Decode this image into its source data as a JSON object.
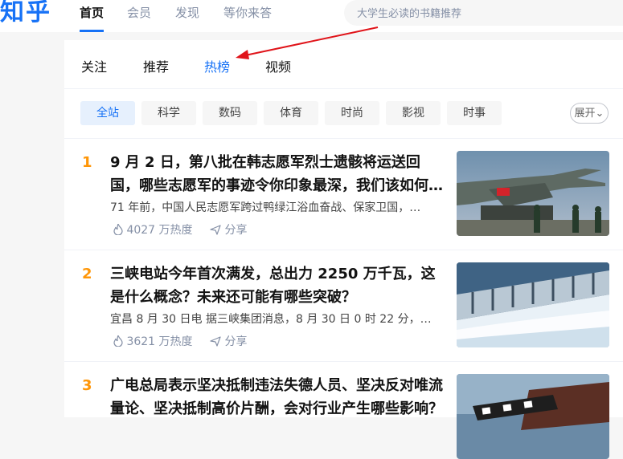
{
  "header": {
    "logo": "知乎",
    "nav": [
      "首页",
      "会员",
      "发现",
      "等你来答"
    ],
    "search_placeholder": "大学生必读的书籍推荐"
  },
  "tabs": [
    "关注",
    "推荐",
    "热榜",
    "视频"
  ],
  "active_tab": "热榜",
  "categories": [
    "全站",
    "科学",
    "数码",
    "体育",
    "时尚",
    "影视",
    "时事"
  ],
  "expand_label": "展开",
  "hot_list": [
    {
      "rank": "1",
      "title": "9 月 2 日，第八批在韩志愿军烈士遗骸将运送回国，哪些志愿军的事迹令你印象最深，我们该如何…",
      "excerpt": "71 年前，中国人民志愿军跨过鸭绿江浴血奋战、保家卫国，…",
      "heat": "4027 万热度",
      "share": "分享"
    },
    {
      "rank": "2",
      "title": "三峡电站今年首次满发，总出力 2250 万千瓦，这是什么概念？未来还可能有哪些突破？",
      "excerpt": "宜昌 8 月 30 日电 据三峡集团消息，8 月 30 日 0 时 22 分，…",
      "heat": "3621 万热度",
      "share": "分享"
    },
    {
      "rank": "3",
      "title": "广电总局表示坚决抵制违法失德人员、坚决反对唯流量论、坚决抵制高价片酬，会对行业产生哪些影响？",
      "excerpt": "",
      "heat": "",
      "share": ""
    }
  ],
  "colors": {
    "brand": "#1772f6",
    "rank": "#ff9607",
    "arrow": "#e0141a"
  },
  "icons": [
    "flame-icon",
    "share-icon"
  ]
}
